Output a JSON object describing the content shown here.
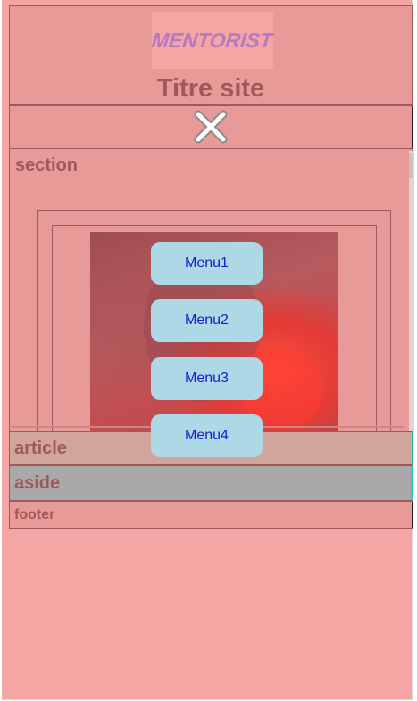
{
  "header": {
    "logo_text": "MENTORIST",
    "site_title": "Titre site"
  },
  "nav": {
    "close_icon": "close-x-icon",
    "menu_items": [
      "Menu1",
      "Menu2",
      "Menu3",
      "Menu4"
    ]
  },
  "section": {
    "label": "section"
  },
  "article": {
    "label": "article"
  },
  "aside": {
    "label": "aside"
  },
  "footer": {
    "label": "footer"
  },
  "colors": {
    "background": "#f4a6a4",
    "overlay": "#e89a98",
    "label_text": "#a35858",
    "menu_button": "#add8e6",
    "menu_text": "#1a1acc",
    "aside_background": "#a9a9a9"
  }
}
